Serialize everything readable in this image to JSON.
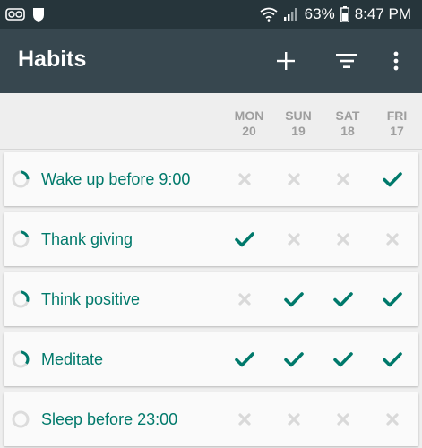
{
  "status_bar": {
    "battery": "63%",
    "time": "8:47 PM",
    "icons": [
      "voicemail-icon",
      "shield-icon",
      "wifi-icon",
      "signal-icon",
      "battery-icon"
    ]
  },
  "app_bar": {
    "title": "Habits",
    "actions": [
      "add-icon",
      "filter-icon",
      "overflow-menu-icon"
    ]
  },
  "days": [
    {
      "name": "MON",
      "num": "20"
    },
    {
      "name": "SUN",
      "num": "19"
    },
    {
      "name": "SAT",
      "num": "18"
    },
    {
      "name": "FRI",
      "num": "17"
    }
  ],
  "habits": [
    {
      "name": "Wake up before 9:00",
      "score": 0.25,
      "checks": [
        false,
        false,
        false,
        true
      ]
    },
    {
      "name": "Thank giving",
      "score": 0.2,
      "checks": [
        true,
        false,
        false,
        false
      ]
    },
    {
      "name": "Think positive",
      "score": 0.3,
      "checks": [
        false,
        true,
        true,
        true
      ]
    },
    {
      "name": "Meditate",
      "score": 0.35,
      "checks": [
        true,
        true,
        true,
        true
      ]
    },
    {
      "name": "Sleep before 23:00",
      "score": 0.0,
      "checks": [
        false,
        false,
        false,
        false
      ]
    }
  ],
  "colors": {
    "accent": "#00796b",
    "unchecked": "#d9d9d9",
    "appbar": "#37474f",
    "statusbar": "#26353b"
  }
}
